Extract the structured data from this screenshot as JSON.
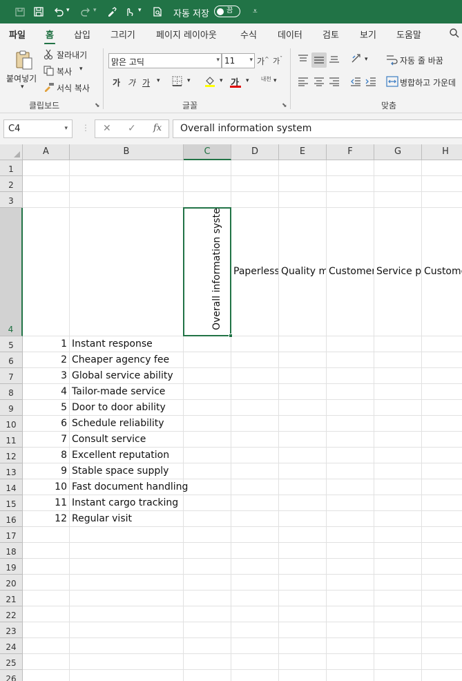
{
  "titlebar": {
    "autosave_label": "자동 저장",
    "autosave_state": "끔",
    "accent_color": "#217346"
  },
  "tabs": [
    {
      "label": "파일"
    },
    {
      "label": "홈"
    },
    {
      "label": "삽입"
    },
    {
      "label": "그리기"
    },
    {
      "label": "페이지 레이아웃"
    },
    {
      "label": "수식"
    },
    {
      "label": "데이터"
    },
    {
      "label": "검토"
    },
    {
      "label": "보기"
    },
    {
      "label": "도움말"
    }
  ],
  "ribbon": {
    "clipboard": {
      "group_label": "클립보드",
      "paste_label": "붙여넣기",
      "cut_label": "잘라내기",
      "copy_label": "복사",
      "format_painter_label": "서식 복사"
    },
    "font": {
      "group_label": "글꼴",
      "font_name": "맑은 고딕",
      "font_size": "11",
      "bold_label": "가",
      "italic_label": "가",
      "underline_label": "가",
      "font_color_label": "가",
      "phonetic_label": "내천"
    },
    "alignment": {
      "group_label": "맞춤",
      "wrap_text_label": "자동 줄 바꿈",
      "merge_center_label": "병합하고 가운데"
    }
  },
  "formula_bar": {
    "name_box": "C4",
    "fx_label": "fx",
    "content": "Overall information system"
  },
  "sheet": {
    "columns": [
      "A",
      "B",
      "C",
      "D",
      "E",
      "F",
      "G",
      "H"
    ],
    "selected_column": "C",
    "selected_row": "4",
    "rows": [
      "1",
      "2",
      "3",
      "4",
      "5",
      "6",
      "7",
      "8",
      "9",
      "10",
      "11",
      "12",
      "13",
      "14",
      "15",
      "16",
      "17",
      "18",
      "19",
      "20",
      "21",
      "22",
      "23",
      "24",
      "25",
      "26"
    ],
    "header_row": {
      "C": "Overall information system",
      "D": "Paperless",
      "E": "Quality m",
      "F": "Customer",
      "G": "Service pc",
      "H": "Custome"
    },
    "items": [
      {
        "num": "1",
        "label": "Instant response"
      },
      {
        "num": "2",
        "label": "Cheaper agency fee"
      },
      {
        "num": "3",
        "label": "Global service ability"
      },
      {
        "num": "4",
        "label": "Tailor-made service"
      },
      {
        "num": "5",
        "label": "Door to door ability"
      },
      {
        "num": "6",
        "label": "Schedule reliability"
      },
      {
        "num": "7",
        "label": "Consult service"
      },
      {
        "num": "8",
        "label": "Excellent reputation"
      },
      {
        "num": "9",
        "label": "Stable space supply"
      },
      {
        "num": "10",
        "label": "Fast document handling"
      },
      {
        "num": "11",
        "label": "Instant cargo tracking"
      },
      {
        "num": "12",
        "label": "Regular visit"
      }
    ]
  }
}
